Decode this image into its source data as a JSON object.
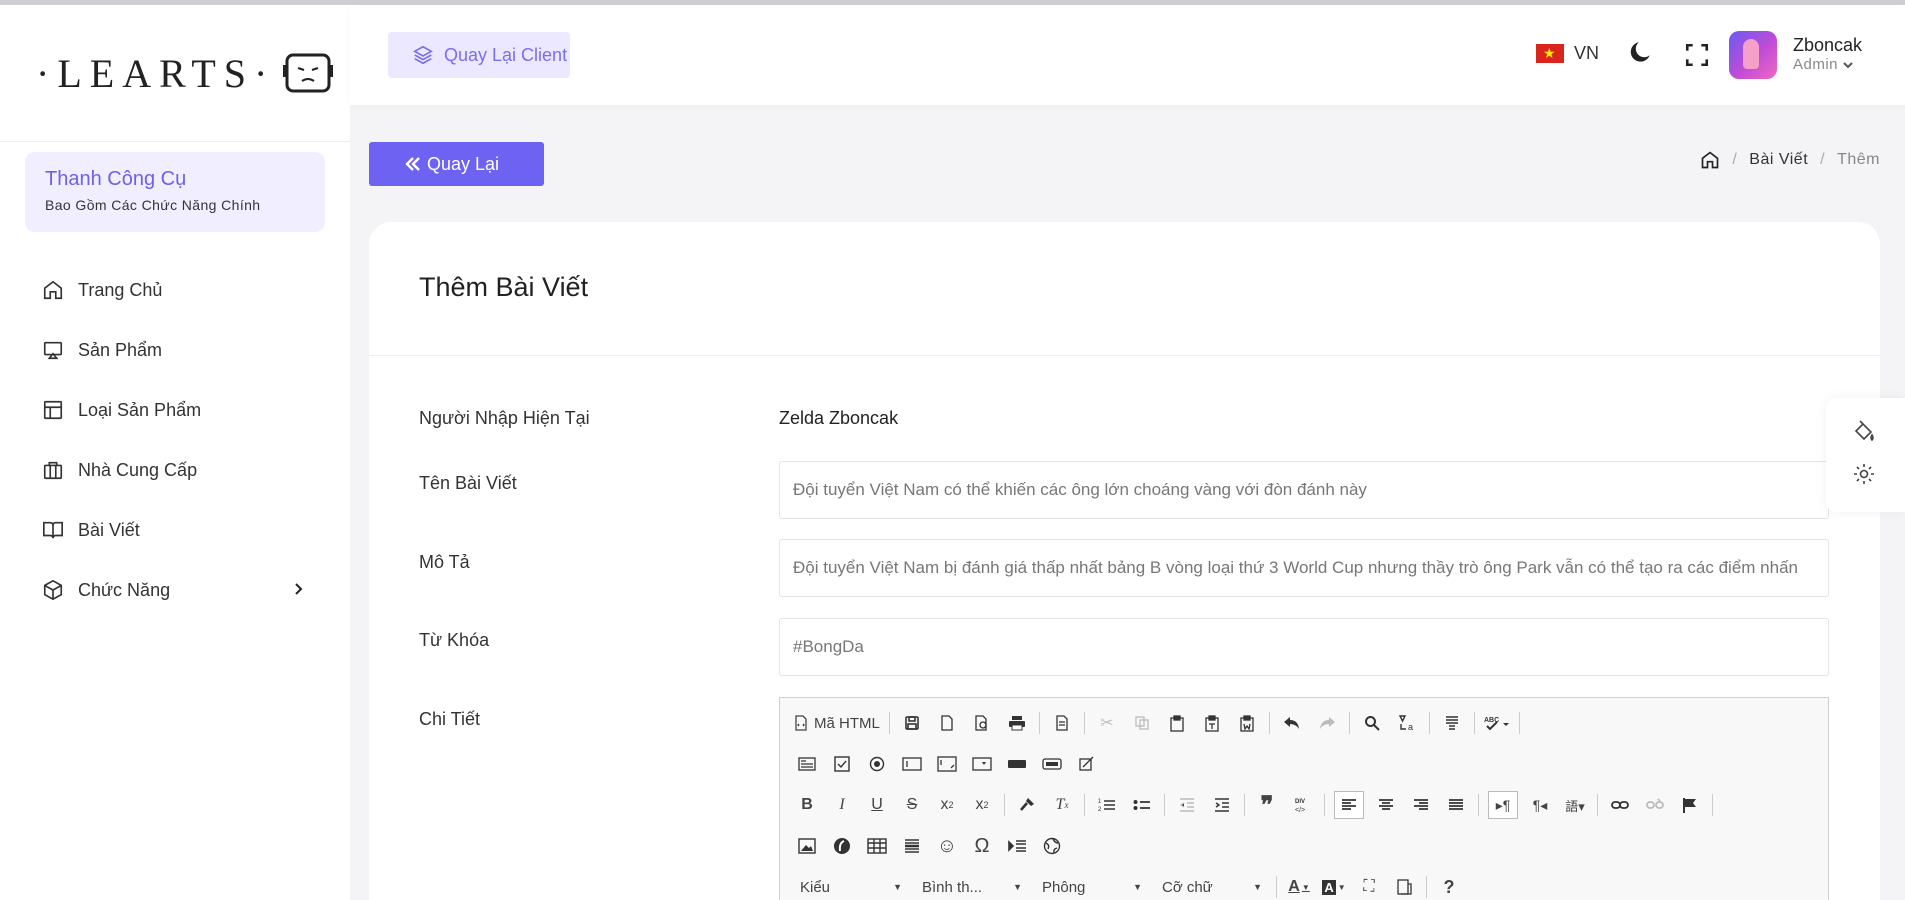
{
  "brand": {
    "logo_text": "·LEARTS·"
  },
  "toolbox": {
    "title": "Thanh Công Cụ",
    "subtitle": "Bao Gồm Các Chức Năng Chính"
  },
  "sidebar": {
    "items": [
      {
        "label": "Trang Chủ",
        "icon": "home-icon"
      },
      {
        "label": "Sản Phẩm",
        "icon": "monitor-icon"
      },
      {
        "label": "Loại Sản Phẩm",
        "icon": "layout-icon"
      },
      {
        "label": "Nhà Cung Cấp",
        "icon": "briefcase-icon"
      },
      {
        "label": "Bài Viết",
        "icon": "book-icon"
      },
      {
        "label": "Chức Năng",
        "icon": "box-icon"
      }
    ]
  },
  "header": {
    "back_client_label": "Quay Lại Client",
    "language": "VN",
    "user": {
      "name": "Zboncak",
      "role": "Admin"
    }
  },
  "main": {
    "back_label": "Quay Lại",
    "breadcrumb": {
      "sep": "/",
      "items": [
        "Bài Viết",
        "Thêm"
      ]
    },
    "card_title": "Thêm Bài Viết"
  },
  "form": {
    "current_user_label": "Người Nhập Hiện Tại",
    "current_user_value": "Zelda Zboncak",
    "title_label": "Tên Bài Viết",
    "title_value": "Đội tuyển Việt Nam có thể khiến các ông lớn choáng vàng với đòn đánh này",
    "desc_label": "Mô Tả",
    "desc_value": "Đội tuyển Việt Nam bị đánh giá thấp nhất bảng B vòng loại thứ 3 World Cup nhưng thầy trò ông Park vẫn có thể tạo ra các điểm nhấn",
    "keyword_label": "Từ Khóa",
    "keyword_value": "#BongDa",
    "detail_label": "Chi Tiết"
  },
  "editor": {
    "source_label": "Mã HTML",
    "combos": {
      "style": "Kiểu",
      "format": "Bình th...",
      "font": "Phông",
      "size": "Cỡ chữ"
    }
  },
  "colors": {
    "accent": "#6e62f2",
    "accent_light": "#ebe8ff",
    "toolbox_bg": "#f1efff"
  }
}
